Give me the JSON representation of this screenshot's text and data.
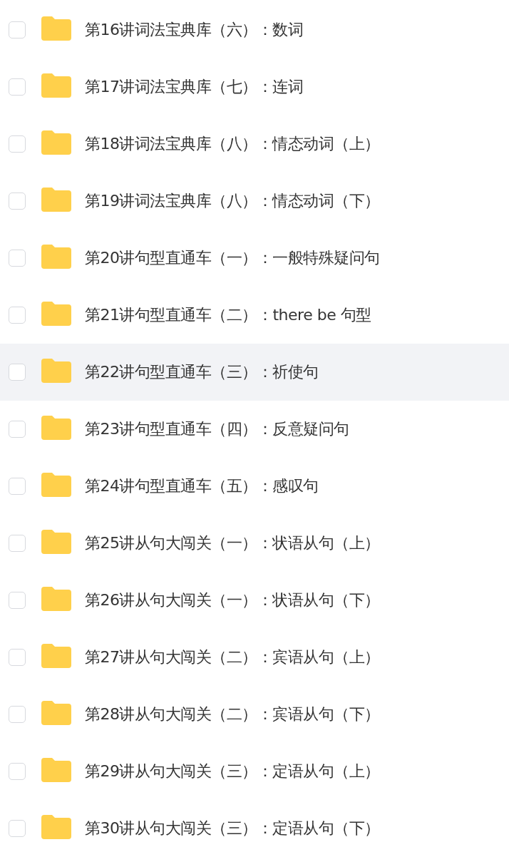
{
  "files": [
    {
      "name": "第16讲词法宝典库（六）：数词",
      "checked": false,
      "highlighted": false
    },
    {
      "name": "第17讲词法宝典库（七）：连词",
      "checked": false,
      "highlighted": false
    },
    {
      "name": "第18讲词法宝典库（八）：情态动词（上）",
      "checked": false,
      "highlighted": false
    },
    {
      "name": "第19讲词法宝典库（八）：情态动词（下）",
      "checked": false,
      "highlighted": false
    },
    {
      "name": "第20讲句型直通车（一）：一般特殊疑问句",
      "checked": false,
      "highlighted": false
    },
    {
      "name": "第21讲句型直通车（二）：there be 句型",
      "checked": false,
      "highlighted": false
    },
    {
      "name": "第22讲句型直通车（三）：祈使句",
      "checked": false,
      "highlighted": true
    },
    {
      "name": "第23讲句型直通车（四）：反意疑问句",
      "checked": false,
      "highlighted": false
    },
    {
      "name": "第24讲句型直通车（五）：感叹句",
      "checked": false,
      "highlighted": false
    },
    {
      "name": "第25讲从句大闯关（一）：状语从句（上）",
      "checked": false,
      "highlighted": false
    },
    {
      "name": "第26讲从句大闯关（一）：状语从句（下）",
      "checked": false,
      "highlighted": false
    },
    {
      "name": "第27讲从句大闯关（二）：宾语从句（上）",
      "checked": false,
      "highlighted": false
    },
    {
      "name": "第28讲从句大闯关（二）：宾语从句（下）",
      "checked": false,
      "highlighted": false
    },
    {
      "name": "第29讲从句大闯关（三）：定语从句（上）",
      "checked": false,
      "highlighted": false
    },
    {
      "name": "第30讲从句大闯关（三）：定语从句（下）",
      "checked": false,
      "highlighted": false
    }
  ]
}
